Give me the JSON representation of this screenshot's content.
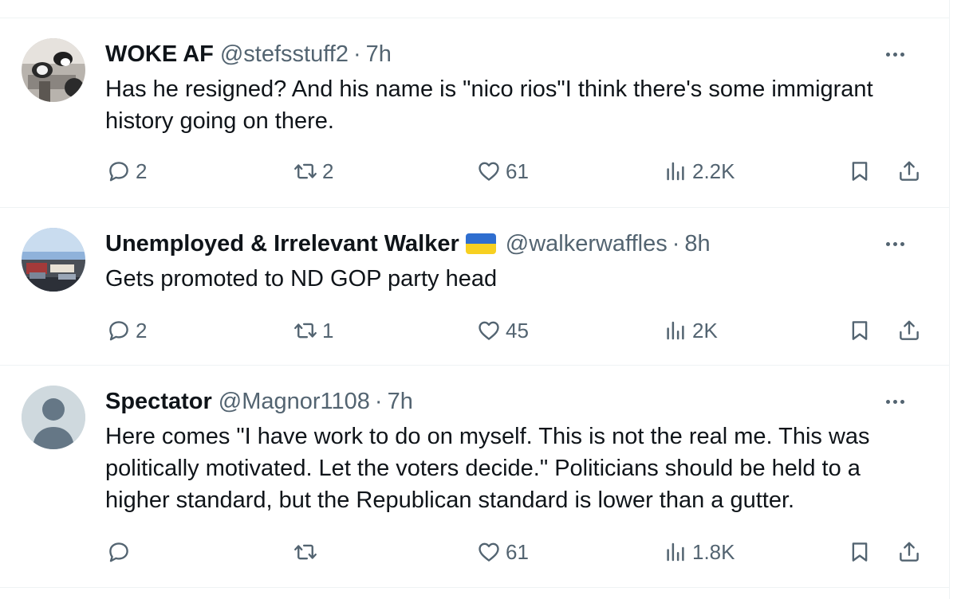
{
  "tweets": [
    {
      "name": "WOKE AF",
      "handle": "@stefsstuff2",
      "dot": "·",
      "time": "7h",
      "text": "Has he resigned? And his name is \"nico rios\"I think there's some immigrant history going on there.",
      "replies": "2",
      "reposts": "2",
      "likes": "61",
      "views": "2.2K"
    },
    {
      "name": "Unemployed & Irrelevant Walker",
      "handle": "@walkerwaffles",
      "dot": "·",
      "time": "8h",
      "text": "Gets promoted to ND GOP party head",
      "replies": "2",
      "reposts": "1",
      "likes": "45",
      "views": "2K"
    },
    {
      "name": "Spectator",
      "handle": "@Magnor1108",
      "dot": "·",
      "time": "7h",
      "text": "Here comes \"I have work to do on myself. This is not the real me. This was politically motivated. Let the voters decide.\" Politicians should be held to a higher standard, but the Republican standard is lower than a gutter.",
      "replies": "",
      "reposts": "",
      "likes": "61",
      "views": "1.8K"
    }
  ],
  "colors": {
    "text": "#0f1419",
    "secondary": "#536471",
    "border": "#eff3f4",
    "flag_blue": "#2f6ecf",
    "flag_yellow": "#f7d021"
  },
  "icons": [
    "reply-icon",
    "repost-icon",
    "like-icon",
    "views-icon",
    "bookmark-icon",
    "share-icon",
    "more-icon"
  ]
}
